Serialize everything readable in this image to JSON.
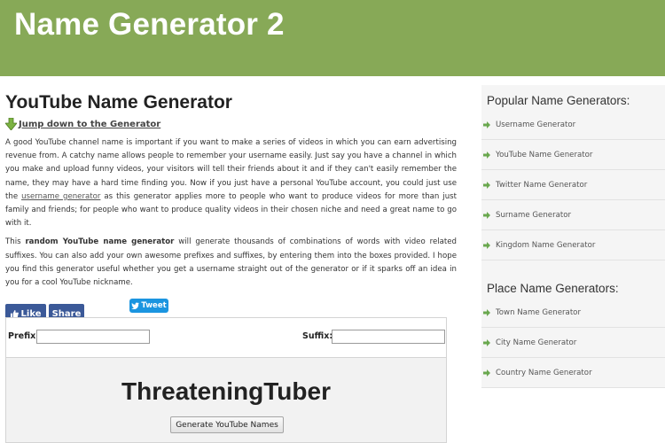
{
  "site": {
    "title": "Name Generator 2"
  },
  "main": {
    "title": "YouTube Name Generator",
    "jump_link": "Jump down to the Generator",
    "para1": {
      "before_link": "A good YouTube channel name is important if you want to make a series of videos in which you can earn advertising revenue from. A catchy name allows people to remember your username easily. Just say you have a channel in which you make and upload funny videos, your visitors will tell their friends about it and if they can't easily remember the name, they may have a hard time finding you. Now if you just have a personal YouTube account, you could just use the ",
      "link": "username generator",
      "after_link": " as this generator applies more to people who want to produce videos for more than just family and friends; for people who want to produce quality videos in their chosen niche and need a great name to go with it."
    },
    "para2": {
      "prefix": "This ",
      "bold": "random YouTube name generator",
      "rest": " will generate thousands of combinations of words with video related suffixes. You can also add your own awesome prefixes and suffixes, by entering them into the boxes provided. I hope you find this generator useful whether you get a username straight out of the generator or if it sparks off an idea in you for a cool YouTube nickname."
    },
    "social": {
      "like": "Like",
      "share": "Share",
      "tweet": "Tweet"
    },
    "generator": {
      "prefix_label": "Prefix:",
      "prefix_value": "",
      "suffix_label": "Suffix:",
      "suffix_value": "",
      "result": "ThreateningTuber",
      "button": "Generate YouTube Names"
    }
  },
  "sidebar": {
    "popular_heading": "Popular Name Generators:",
    "popular": [
      {
        "label": "Username Generator"
      },
      {
        "label": "YouTube Name Generator"
      },
      {
        "label": "Twitter Name Generator"
      },
      {
        "label": "Surname Generator"
      },
      {
        "label": "Kingdom Name Generator"
      }
    ],
    "place_heading": "Place Name Generators:",
    "place": [
      {
        "label": "Town Name Generator"
      },
      {
        "label": "City Name Generator"
      },
      {
        "label": "Country Name Generator"
      }
    ]
  },
  "colors": {
    "header_bg": "#87a957",
    "facebook": "#3b5998",
    "twitter": "#1b95e0",
    "sidebar_arrow": "#6aa84f"
  }
}
